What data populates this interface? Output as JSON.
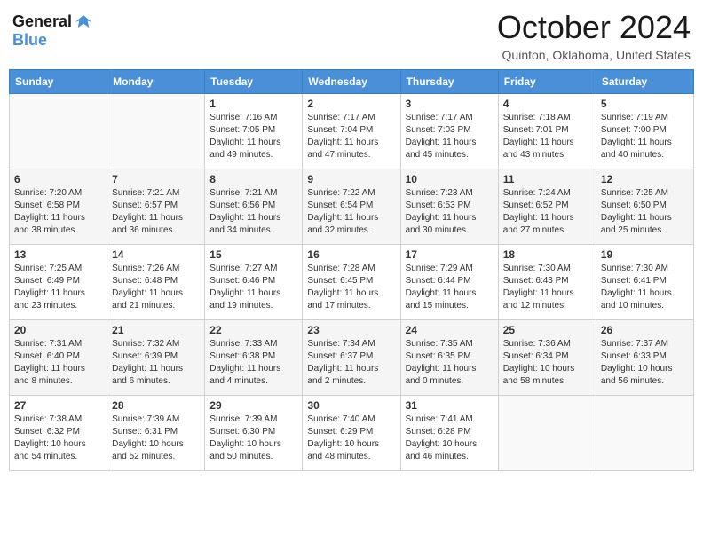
{
  "header": {
    "logo": {
      "line1": "General",
      "line2": "Blue"
    },
    "title": "October 2024",
    "location": "Quinton, Oklahoma, United States"
  },
  "weekdays": [
    "Sunday",
    "Monday",
    "Tuesday",
    "Wednesday",
    "Thursday",
    "Friday",
    "Saturday"
  ],
  "weeks": [
    [
      {
        "day": "",
        "info": ""
      },
      {
        "day": "",
        "info": ""
      },
      {
        "day": "1",
        "info": "Sunrise: 7:16 AM\nSunset: 7:05 PM\nDaylight: 11 hours and 49 minutes."
      },
      {
        "day": "2",
        "info": "Sunrise: 7:17 AM\nSunset: 7:04 PM\nDaylight: 11 hours and 47 minutes."
      },
      {
        "day": "3",
        "info": "Sunrise: 7:17 AM\nSunset: 7:03 PM\nDaylight: 11 hours and 45 minutes."
      },
      {
        "day": "4",
        "info": "Sunrise: 7:18 AM\nSunset: 7:01 PM\nDaylight: 11 hours and 43 minutes."
      },
      {
        "day": "5",
        "info": "Sunrise: 7:19 AM\nSunset: 7:00 PM\nDaylight: 11 hours and 40 minutes."
      }
    ],
    [
      {
        "day": "6",
        "info": "Sunrise: 7:20 AM\nSunset: 6:58 PM\nDaylight: 11 hours and 38 minutes."
      },
      {
        "day": "7",
        "info": "Sunrise: 7:21 AM\nSunset: 6:57 PM\nDaylight: 11 hours and 36 minutes."
      },
      {
        "day": "8",
        "info": "Sunrise: 7:21 AM\nSunset: 6:56 PM\nDaylight: 11 hours and 34 minutes."
      },
      {
        "day": "9",
        "info": "Sunrise: 7:22 AM\nSunset: 6:54 PM\nDaylight: 11 hours and 32 minutes."
      },
      {
        "day": "10",
        "info": "Sunrise: 7:23 AM\nSunset: 6:53 PM\nDaylight: 11 hours and 30 minutes."
      },
      {
        "day": "11",
        "info": "Sunrise: 7:24 AM\nSunset: 6:52 PM\nDaylight: 11 hours and 27 minutes."
      },
      {
        "day": "12",
        "info": "Sunrise: 7:25 AM\nSunset: 6:50 PM\nDaylight: 11 hours and 25 minutes."
      }
    ],
    [
      {
        "day": "13",
        "info": "Sunrise: 7:25 AM\nSunset: 6:49 PM\nDaylight: 11 hours and 23 minutes."
      },
      {
        "day": "14",
        "info": "Sunrise: 7:26 AM\nSunset: 6:48 PM\nDaylight: 11 hours and 21 minutes."
      },
      {
        "day": "15",
        "info": "Sunrise: 7:27 AM\nSunset: 6:46 PM\nDaylight: 11 hours and 19 minutes."
      },
      {
        "day": "16",
        "info": "Sunrise: 7:28 AM\nSunset: 6:45 PM\nDaylight: 11 hours and 17 minutes."
      },
      {
        "day": "17",
        "info": "Sunrise: 7:29 AM\nSunset: 6:44 PM\nDaylight: 11 hours and 15 minutes."
      },
      {
        "day": "18",
        "info": "Sunrise: 7:30 AM\nSunset: 6:43 PM\nDaylight: 11 hours and 12 minutes."
      },
      {
        "day": "19",
        "info": "Sunrise: 7:30 AM\nSunset: 6:41 PM\nDaylight: 11 hours and 10 minutes."
      }
    ],
    [
      {
        "day": "20",
        "info": "Sunrise: 7:31 AM\nSunset: 6:40 PM\nDaylight: 11 hours and 8 minutes."
      },
      {
        "day": "21",
        "info": "Sunrise: 7:32 AM\nSunset: 6:39 PM\nDaylight: 11 hours and 6 minutes."
      },
      {
        "day": "22",
        "info": "Sunrise: 7:33 AM\nSunset: 6:38 PM\nDaylight: 11 hours and 4 minutes."
      },
      {
        "day": "23",
        "info": "Sunrise: 7:34 AM\nSunset: 6:37 PM\nDaylight: 11 hours and 2 minutes."
      },
      {
        "day": "24",
        "info": "Sunrise: 7:35 AM\nSunset: 6:35 PM\nDaylight: 11 hours and 0 minutes."
      },
      {
        "day": "25",
        "info": "Sunrise: 7:36 AM\nSunset: 6:34 PM\nDaylight: 10 hours and 58 minutes."
      },
      {
        "day": "26",
        "info": "Sunrise: 7:37 AM\nSunset: 6:33 PM\nDaylight: 10 hours and 56 minutes."
      }
    ],
    [
      {
        "day": "27",
        "info": "Sunrise: 7:38 AM\nSunset: 6:32 PM\nDaylight: 10 hours and 54 minutes."
      },
      {
        "day": "28",
        "info": "Sunrise: 7:39 AM\nSunset: 6:31 PM\nDaylight: 10 hours and 52 minutes."
      },
      {
        "day": "29",
        "info": "Sunrise: 7:39 AM\nSunset: 6:30 PM\nDaylight: 10 hours and 50 minutes."
      },
      {
        "day": "30",
        "info": "Sunrise: 7:40 AM\nSunset: 6:29 PM\nDaylight: 10 hours and 48 minutes."
      },
      {
        "day": "31",
        "info": "Sunrise: 7:41 AM\nSunset: 6:28 PM\nDaylight: 10 hours and 46 minutes."
      },
      {
        "day": "",
        "info": ""
      },
      {
        "day": "",
        "info": ""
      }
    ]
  ]
}
